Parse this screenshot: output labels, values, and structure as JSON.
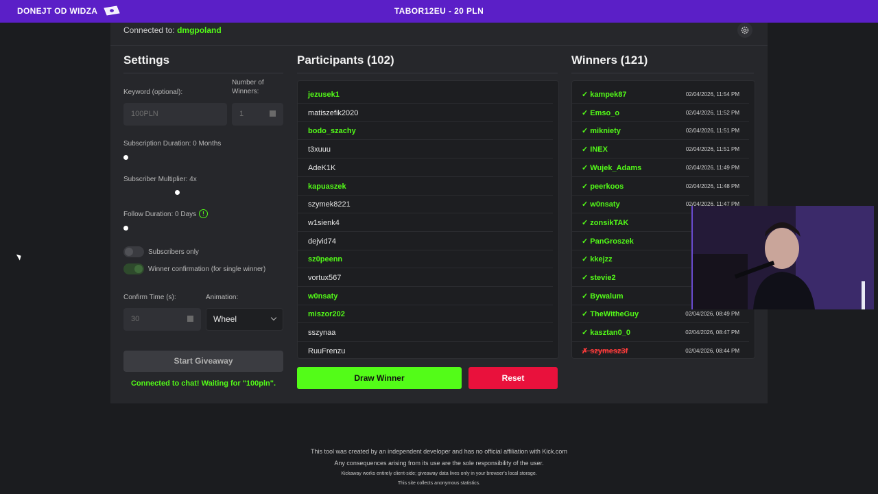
{
  "overlay": {
    "donation_label": "DONEJT OD WIDZA",
    "donation_text": "TABOR12EU - 20 PLN",
    "accent": "#5b1fc7"
  },
  "header": {
    "connected_prefix": "Connected to:",
    "channel": "dmgpoland",
    "settings_icon": "gear-icon"
  },
  "settings": {
    "title": "Settings",
    "keyword_label": "Keyword (optional):",
    "keyword_placeholder": "100PLN",
    "winners_label_1": "Number of",
    "winners_label_2": "Winners:",
    "winners_value": "1",
    "sub_duration_label": "Subscription Duration: 0 Months",
    "sub_duration_value": 0,
    "sub_multiplier_label": "Subscriber Multiplier: 4x",
    "sub_multiplier_value": 4,
    "follow_duration_label": "Follow Duration: 0 Days",
    "follow_duration_value": 0,
    "info_glyph": "!",
    "subscribers_only_label": "Subscribers only",
    "subscribers_only": false,
    "winner_confirm_label": "Winner confirmation (for single winner)",
    "winner_confirm": true,
    "confirm_time_label": "Confirm Time (s):",
    "confirm_time_value": "30",
    "animation_label": "Animation:",
    "animation_value": "Wheel",
    "start_button": "Start Giveaway",
    "status": "Connected to chat! Waiting for \"100pln\"."
  },
  "participants": {
    "title": "Participants (102)",
    "rows": [
      {
        "name": "jezusek1",
        "highlight": true
      },
      {
        "name": "matiszefik2020",
        "highlight": false
      },
      {
        "name": "bodo_szachy",
        "highlight": true
      },
      {
        "name": "t3xuuu",
        "highlight": false
      },
      {
        "name": "AdeK1K",
        "highlight": false
      },
      {
        "name": "kapuaszek",
        "highlight": true
      },
      {
        "name": "szymek8221",
        "highlight": false
      },
      {
        "name": "w1sienk4",
        "highlight": false
      },
      {
        "name": "dejvid74",
        "highlight": false
      },
      {
        "name": "sz0peenn",
        "highlight": true
      },
      {
        "name": "vortux567",
        "highlight": false
      },
      {
        "name": "w0nsaty",
        "highlight": true
      },
      {
        "name": "miszor202",
        "highlight": true
      },
      {
        "name": "sszynaa",
        "highlight": false
      },
      {
        "name": "RuuFrenzu",
        "highlight": false
      }
    ],
    "draw_button": "Draw Winner",
    "reset_button": "Reset"
  },
  "winners": {
    "title": "Winners (121)",
    "rows": [
      {
        "name": "✓ kampek87",
        "date": "02/04/2026, 11:54 PM",
        "confirmed": true
      },
      {
        "name": "✓ Emso_o",
        "date": "02/04/2026, 11:52 PM",
        "confirmed": true
      },
      {
        "name": "✓ miknietу",
        "date": "02/04/2026, 11:51 PM",
        "confirmed": true
      },
      {
        "name": "✓ INEX",
        "date": "02/04/2026, 11:51 PM",
        "confirmed": true
      },
      {
        "name": "✓ Wujek_Adams",
        "date": "02/04/2026, 11:49 PM",
        "confirmed": true
      },
      {
        "name": "✓ peerkoos",
        "date": "02/04/2026, 11:48 PM",
        "confirmed": true
      },
      {
        "name": "✓ w0nsaty",
        "date": "02/04/2026, 11:47 PM",
        "confirmed": true
      },
      {
        "name": "✓ zonsikTAK",
        "date": "",
        "confirmed": true
      },
      {
        "name": "✓ PanGroszek",
        "date": "",
        "confirmed": true
      },
      {
        "name": "✓ kkejzz",
        "date": "",
        "confirmed": true
      },
      {
        "name": "✓ stevie2",
        "date": "",
        "confirmed": true
      },
      {
        "name": "✓ Bywalum",
        "date": "",
        "confirmed": true
      },
      {
        "name": "✓ TheWitheGuy",
        "date": "02/04/2026, 08:49 PM",
        "confirmed": true
      },
      {
        "name": "✓ kasztan0_0",
        "date": "02/04/2026, 08:47 PM",
        "confirmed": true
      },
      {
        "name": "✗ szymesz3f",
        "date": "02/04/2026, 08:44 PM",
        "confirmed": false
      }
    ]
  },
  "footer": {
    "line1": "This tool was created by an independent developer and has no official affiliation with Kick.com",
    "line2": "Any consequences arising from its use are the sole responsibility of the user.",
    "line3": "Kickaway works entirely client-side; giveaway data lives only in your browser's local storage.",
    "line4": "This site collects anonymous statistics."
  }
}
